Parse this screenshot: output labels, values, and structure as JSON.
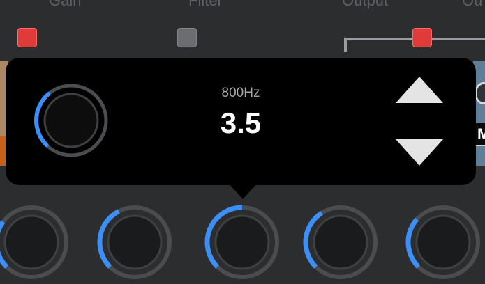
{
  "top_labels": [
    "Gain",
    "Filter",
    "Output",
    "Ou"
  ],
  "buttons": {
    "left_square_color": "#e03b3b",
    "middle_square_color": "#6b6d70",
    "right_square_color": "#e03b3b"
  },
  "popup": {
    "frequency_label": "800Hz",
    "value": "3.5",
    "knob_level": 0.35,
    "accent": "#3d8ef5",
    "track_color": "#4a4c4f",
    "increment_icon": "triangle-up-icon",
    "decrement_icon": "triangle-down-icon"
  },
  "side_strip": {
    "right_badge_letter": "M"
  },
  "bottom_knobs": [
    {
      "level": 0.3
    },
    {
      "level": 0.4
    },
    {
      "level": 0.5
    },
    {
      "level": 0.38
    },
    {
      "level": 0.32
    }
  ]
}
